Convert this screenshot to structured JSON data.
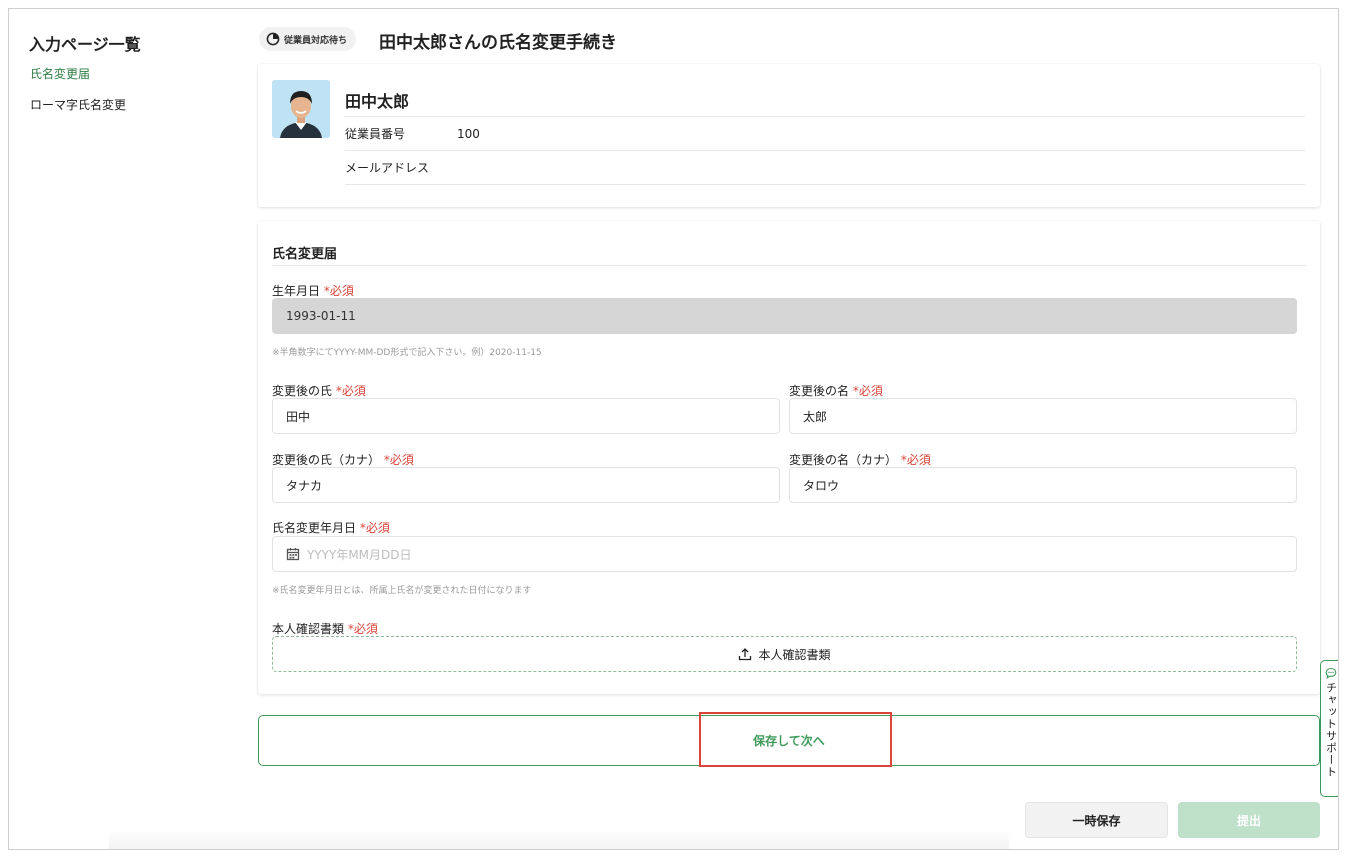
{
  "sidebar": {
    "title": "入力ページ一覧",
    "items": [
      {
        "label": "氏名変更届",
        "active": true
      },
      {
        "label": "ローマ字氏名変更",
        "active": false
      }
    ]
  },
  "header": {
    "status_badge": "従業員対応待ち",
    "title": "田中太郎さんの氏名変更手続き"
  },
  "profile": {
    "name": "田中太郎",
    "employee_number_label": "従業員番号",
    "employee_number": "100",
    "email_label": "メールアドレス",
    "email": ""
  },
  "form": {
    "section_title": "氏名変更届",
    "required_mark": "*必須",
    "birthdate": {
      "label": "生年月日",
      "value": "1993-01-11",
      "hint": "※半角数字にてYYYY-MM-DD形式で記入下さい。例）2020-11-15"
    },
    "last_name": {
      "label": "変更後の氏",
      "value": "田中"
    },
    "first_name": {
      "label": "変更後の名",
      "value": "太郎"
    },
    "last_name_kana": {
      "label": "変更後の氏（カナ）",
      "value": "タナカ"
    },
    "first_name_kana": {
      "label": "変更後の名（カナ）",
      "value": "タロウ"
    },
    "change_date": {
      "label": "氏名変更年月日",
      "placeholder": "YYYY年MM月DD日",
      "hint": "※氏名変更年月日とは、所属上氏名が変更された日付になります"
    },
    "id_document": {
      "label": "本人確認書類",
      "upload_label": "本人確認書類"
    }
  },
  "actions": {
    "save_next": "保存して次へ",
    "temp_save": "一時保存",
    "submit": "提出"
  },
  "chat_support": {
    "label": "チャットサポート"
  },
  "colors": {
    "accent": "#3f9a5b",
    "required": "#d9453a",
    "highlight": "#d9453a",
    "submit_disabled": "#bfe0c9"
  }
}
